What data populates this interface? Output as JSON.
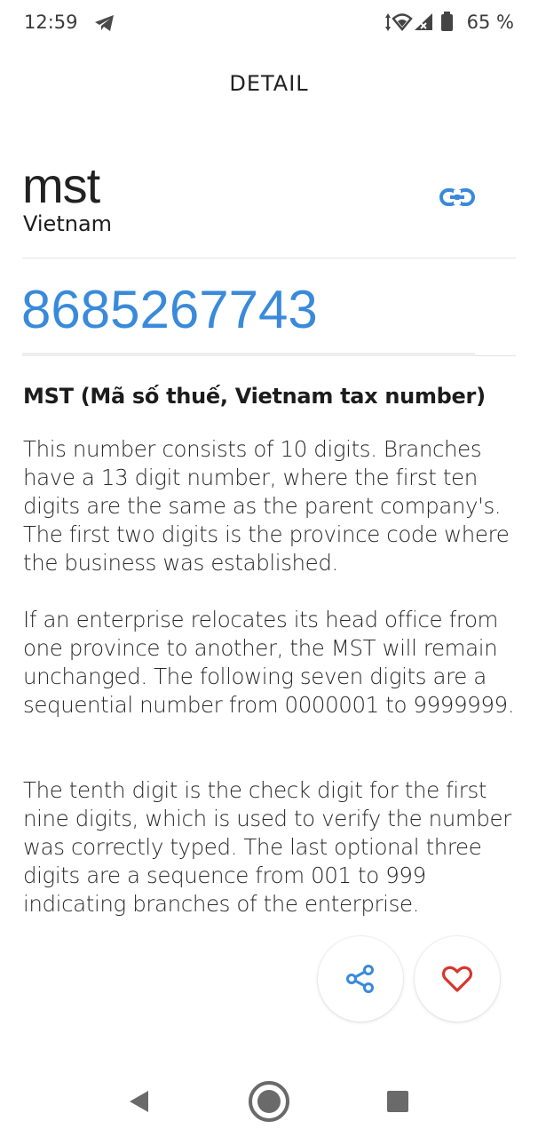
{
  "status_bar": {
    "time": "12:59",
    "battery_percent": "65 %",
    "icons": [
      "telegram-icon",
      "data-arrows-icon",
      "wifi-icon",
      "signal-icon",
      "battery-icon"
    ]
  },
  "page": {
    "title": "DETAIL"
  },
  "header": {
    "code_name": "mst",
    "country": "Vietnam",
    "link_icon": "link-icon"
  },
  "tax_number": "8685267743",
  "section": {
    "heading": "MST (Mã số thuế, Vietnam tax number)",
    "paragraphs": [
      "This number consists of 10 digits. Branches have a 13 digit number, where the first ten digits are the same as the parent company's. The first two digits is the province code where the business was established.",
      "If an enterprise relocates its head office from one province to another, the MST will remain unchanged. The following seven digits are a sequential number from 0000001 to 9999999.",
      "The tenth digit is the check digit for the first nine digits, which is used to verify the number was correctly typed. The last optional three digits are a sequence from 001 to 999 indicating branches of the enterprise."
    ]
  },
  "actions": {
    "share_icon": "share-icon",
    "favorite_icon": "heart-icon"
  },
  "colors": {
    "accent": "#3a8adb",
    "favorite": "#d9342b"
  },
  "nav": {
    "icons": [
      "back-icon",
      "home-icon",
      "recents-icon"
    ]
  }
}
